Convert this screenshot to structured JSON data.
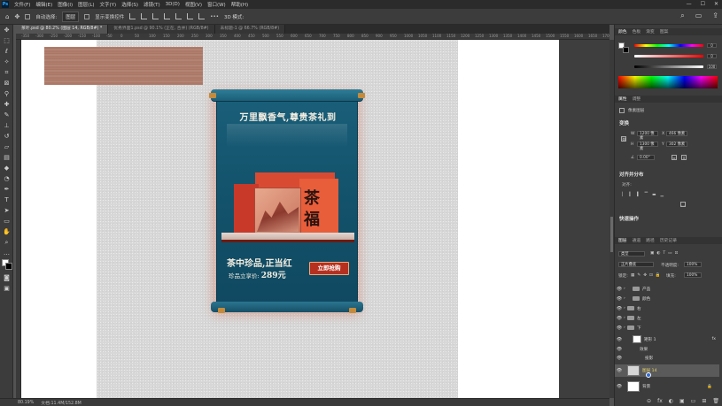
{
  "menubar": {
    "logo": "Ps",
    "items": [
      "文件(F)",
      "编辑(E)",
      "图像(I)",
      "图层(L)",
      "文字(Y)",
      "选择(S)",
      "滤镜(T)",
      "3D(D)",
      "视图(V)",
      "窗口(W)",
      "帮助(H)"
    ],
    "window_controls": [
      "—",
      "☐",
      "✕"
    ]
  },
  "optbar": {
    "move_icon": "✥",
    "auto_select_label": "自动选择:",
    "auto_select_value": "图层",
    "transform_label": "显示变换控件",
    "more": "•••",
    "mode_label": "3D 模式:"
  },
  "tabs": [
    {
      "label": "茶叶.psd @ 80.2% (图层 14, RGB/8#) *",
      "active": true
    },
    {
      "label": "优秀界面1.psd @ 90.1% (正在, 合并) (RGB/8#)",
      "active": false
    },
    {
      "label": "未标题-1 @ 66.7% (RGB/8#)",
      "active": false
    }
  ],
  "ruler": {
    "ticks": [
      "-350",
      "-300",
      "-250",
      "-200",
      "-150",
      "-100",
      "-50",
      "0",
      "50",
      "100",
      "150",
      "200",
      "250",
      "300",
      "350",
      "400",
      "450",
      "500",
      "550",
      "600",
      "650",
      "700",
      "750",
      "800",
      "850",
      "900",
      "950",
      "1000",
      "1050",
      "1100",
      "1150",
      "1200",
      "1250",
      "1300",
      "1350",
      "1400",
      "1450",
      "1500",
      "1550",
      "1600",
      "1650",
      "1700"
    ]
  },
  "poster": {
    "headline": "万里飘香气,尊贵茶礼到",
    "box_text": "茶福",
    "subtitle": "茶中珍品,正当红",
    "price_label": "珍品立享价:",
    "price_value": "289元",
    "buy_button": "立即抢购"
  },
  "statusbar": {
    "zoom": "80.19%",
    "doc": "文档:11.4M/152.8M"
  },
  "panel": {
    "color_tabs": [
      "颜色",
      "色板",
      "渐变",
      "图案"
    ],
    "sliders": [
      {
        "label": "",
        "value": "0"
      },
      {
        "label": "",
        "value": "0"
      },
      {
        "label": "",
        "value": "100"
      }
    ],
    "props_tabs": [
      "属性",
      "调整"
    ],
    "props_type": "像素图层",
    "transform_title": "变换",
    "w_label": "W",
    "w_value": "1200 像素",
    "h_label": "H",
    "h_value": "1300 像素",
    "x_label": "X",
    "x_value": "466 像素",
    "y_label": "Y",
    "y_value": "302 像素",
    "angle_value": "0.00°",
    "align_title": "对齐并分布",
    "align_label": "对齐:",
    "quick_title": "快速操作",
    "layers_tabs": [
      "图层",
      "通道",
      "路径",
      "历史记录"
    ],
    "filter_label": "类型",
    "blend_mode": "正片叠底",
    "opacity_label": "不透明度:",
    "opacity_value": "100%",
    "lock_label": "锁定:",
    "fill_label": "填充:",
    "fill_value": "100%",
    "layers": [
      {
        "name": "产品",
        "kind": "folder",
        "selected": false
      },
      {
        "name": "颜色",
        "kind": "folder",
        "selected": false
      },
      {
        "name": "右",
        "kind": "folder",
        "selected": false
      },
      {
        "name": "左",
        "kind": "folder",
        "selected": false
      },
      {
        "name": "下",
        "kind": "folder",
        "selected": false
      },
      {
        "name": "矩形 1",
        "kind": "image",
        "selected": false
      },
      {
        "name": "效果",
        "kind": "fx",
        "selected": false
      },
      {
        "name": "投影",
        "kind": "fx",
        "selected": false
      },
      {
        "name": "图层 14",
        "kind": "image",
        "selected": true
      },
      {
        "name": "背景",
        "kind": "bg",
        "selected": false
      }
    ],
    "bottom_icons": [
      "⊝",
      "fx",
      "◐",
      "▣",
      "▭",
      "⊞",
      "🗑"
    ]
  },
  "colors": {
    "accent": "#1a5f7a",
    "button_red": "#b5301f",
    "swatch_wood": "#b47f6f"
  }
}
